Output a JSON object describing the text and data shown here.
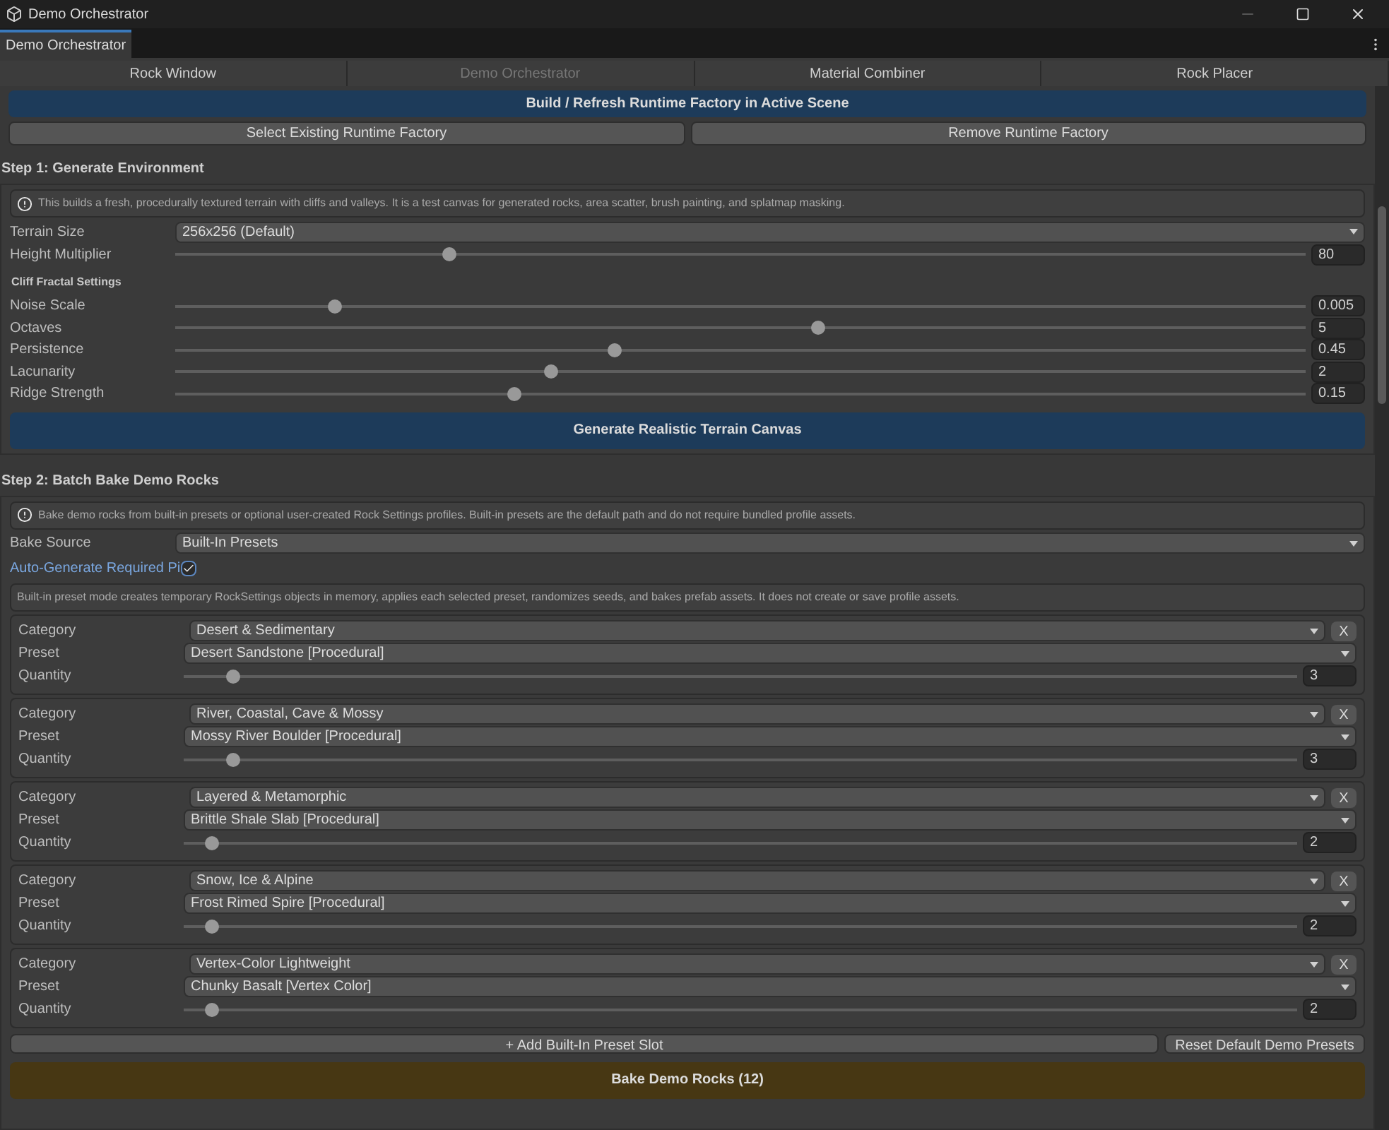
{
  "window": {
    "title": "Demo Orchestrator"
  },
  "doc_tab": {
    "label": "Demo Orchestrator"
  },
  "tool_tabs": [
    {
      "label": "Rock Window",
      "selected": false
    },
    {
      "label": "Demo Orchestrator",
      "selected": true
    },
    {
      "label": "Material Combiner",
      "selected": false
    },
    {
      "label": "Rock Placer",
      "selected": false
    }
  ],
  "factory": {
    "build_button": "Build / Refresh Runtime Factory in Active Scene",
    "select_button": "Select Existing Runtime Factory",
    "remove_button": "Remove Runtime Factory"
  },
  "step1": {
    "title": "Step 1: Generate Environment",
    "info": "This builds a fresh, procedurally textured terrain with cliffs and valleys. It is a test canvas for generated rocks, area scatter, brush painting, and splatmap masking.",
    "terrain_size": {
      "label": "Terrain Size",
      "value": "256x256 (Default)"
    },
    "height": {
      "label": "Height Multiplier",
      "level": 0.243,
      "value": "80"
    },
    "subheading": "Cliff Fractal Settings",
    "sliders": [
      {
        "label": "Noise Scale",
        "level": 0.141,
        "value": "0.005"
      },
      {
        "label": "Octaves",
        "level": 0.569,
        "value": "5"
      },
      {
        "label": "Persistence",
        "level": 0.389,
        "value": "0.45"
      },
      {
        "label": "Lacunarity",
        "level": 0.333,
        "value": "2"
      },
      {
        "label": "Ridge Strength",
        "level": 0.3,
        "value": "0.15"
      }
    ],
    "generate_button": "Generate Realistic Terrain Canvas"
  },
  "step2": {
    "title": "Step 2: Batch Bake Demo Rocks",
    "info": "Bake demo rocks from built-in presets or optional user-created Rock Settings profiles. Built-in presets are the default path and do not require bundled profile assets.",
    "bake_source": {
      "label": "Bake Source",
      "value": "Built-In Presets"
    },
    "auto_generate": {
      "label": "Auto-Generate Required Pi",
      "checked": true
    },
    "note": "Built-in preset mode creates temporary RockSettings objects in memory, applies each selected preset, randomizes seeds, and bakes prefab assets. It does not create or save profile assets.",
    "slots": [
      {
        "category_label": "Category",
        "category": "Desert & Sedimentary",
        "preset_label": "Preset",
        "preset": "Desert Sandstone [Procedural]",
        "quantity_label": "Quantity",
        "level": 0.045,
        "quantity": "3",
        "remove": "X"
      },
      {
        "category_label": "Category",
        "category": "River, Coastal, Cave & Mossy",
        "preset_label": "Preset",
        "preset": "Mossy River Boulder [Procedural]",
        "quantity_label": "Quantity",
        "level": 0.045,
        "quantity": "3",
        "remove": "X"
      },
      {
        "category_label": "Category",
        "category": "Layered & Metamorphic",
        "preset_label": "Preset",
        "preset": "Brittle Shale Slab [Procedural]",
        "quantity_label": "Quantity",
        "level": 0.025,
        "quantity": "2",
        "remove": "X"
      },
      {
        "category_label": "Category",
        "category": "Snow, Ice & Alpine",
        "preset_label": "Preset",
        "preset": "Frost Rimed Spire [Procedural]",
        "quantity_label": "Quantity",
        "level": 0.025,
        "quantity": "2",
        "remove": "X"
      },
      {
        "category_label": "Category",
        "category": "Vertex-Color Lightweight",
        "preset_label": "Preset",
        "preset": "Chunky Basalt [Vertex Color]",
        "quantity_label": "Quantity",
        "level": 0.025,
        "quantity": "2",
        "remove": "X"
      }
    ],
    "add_button": "+ Add Built-In Preset Slot",
    "reset_button": "Reset Default Demo Presets",
    "bake_button": "Bake Demo Rocks (12)"
  }
}
